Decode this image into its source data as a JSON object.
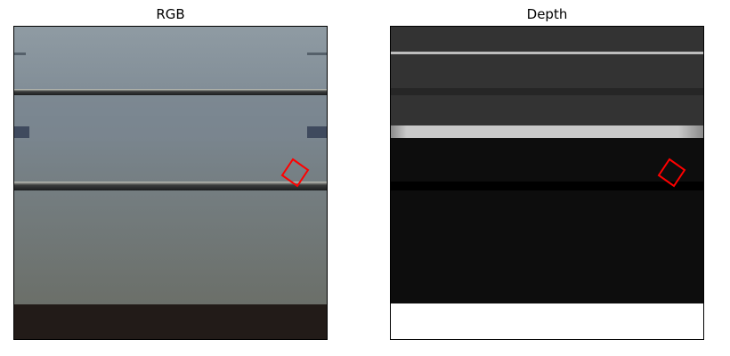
{
  "panels": {
    "rgb": {
      "title": "RGB"
    },
    "depth": {
      "title": "Depth"
    }
  },
  "colors": {
    "marker": "#ff0000",
    "rgb_wall_top": "#8d99a1",
    "rgb_wall_bottom": "#6d706b",
    "rgb_floor": "#221b18",
    "depth_far": "#333333",
    "depth_near": "#0d0d0d",
    "depth_floor": "#ffffff"
  },
  "marker": {
    "shape": "rotated-square",
    "color": "red"
  }
}
